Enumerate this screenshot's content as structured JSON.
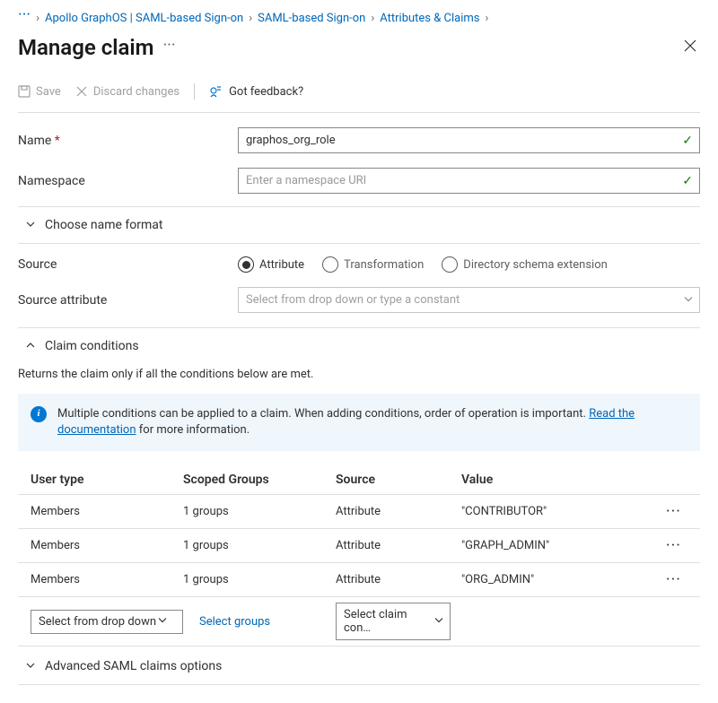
{
  "breadcrumb": {
    "items": [
      "Apollo GraphOS | SAML-based Sign-on",
      "SAML-based Sign-on",
      "Attributes & Claims"
    ]
  },
  "header": {
    "title": "Manage claim"
  },
  "toolbar": {
    "save": "Save",
    "discard": "Discard changes",
    "feedback": "Got feedback?"
  },
  "form": {
    "name_label": "Name",
    "name_value": "graphos_org_role",
    "namespace_label": "Namespace",
    "namespace_placeholder": "Enter a namespace URI"
  },
  "name_format_section": "Choose name format",
  "source": {
    "label": "Source",
    "options": [
      "Attribute",
      "Transformation",
      "Directory schema extension"
    ]
  },
  "source_attr": {
    "label": "Source attribute",
    "placeholder": "Select from drop down or type a constant"
  },
  "conditions": {
    "header": "Claim conditions",
    "desc": "Returns the claim only if all the conditions below are met.",
    "info_prefix": "Multiple conditions can be applied to a claim.  When adding conditions, order of operation is important. ",
    "info_link": "Read the documentation",
    "info_suffix": " for more information.",
    "columns": {
      "user": "User type",
      "groups": "Scoped Groups",
      "source": "Source",
      "value": "Value"
    },
    "rows": [
      {
        "user": "Members",
        "groups": "1 groups",
        "source": "Attribute",
        "value": "\"CONTRIBUTOR\""
      },
      {
        "user": "Members",
        "groups": "1 groups",
        "source": "Attribute",
        "value": "\"GRAPH_ADMIN\""
      },
      {
        "user": "Members",
        "groups": "1 groups",
        "source": "Attribute",
        "value": "\"ORG_ADMIN\""
      }
    ],
    "new_row": {
      "user_placeholder": "Select from drop down",
      "groups_link": "Select groups",
      "source_placeholder": "Select claim con…"
    }
  },
  "advanced_section": "Advanced SAML claims options"
}
